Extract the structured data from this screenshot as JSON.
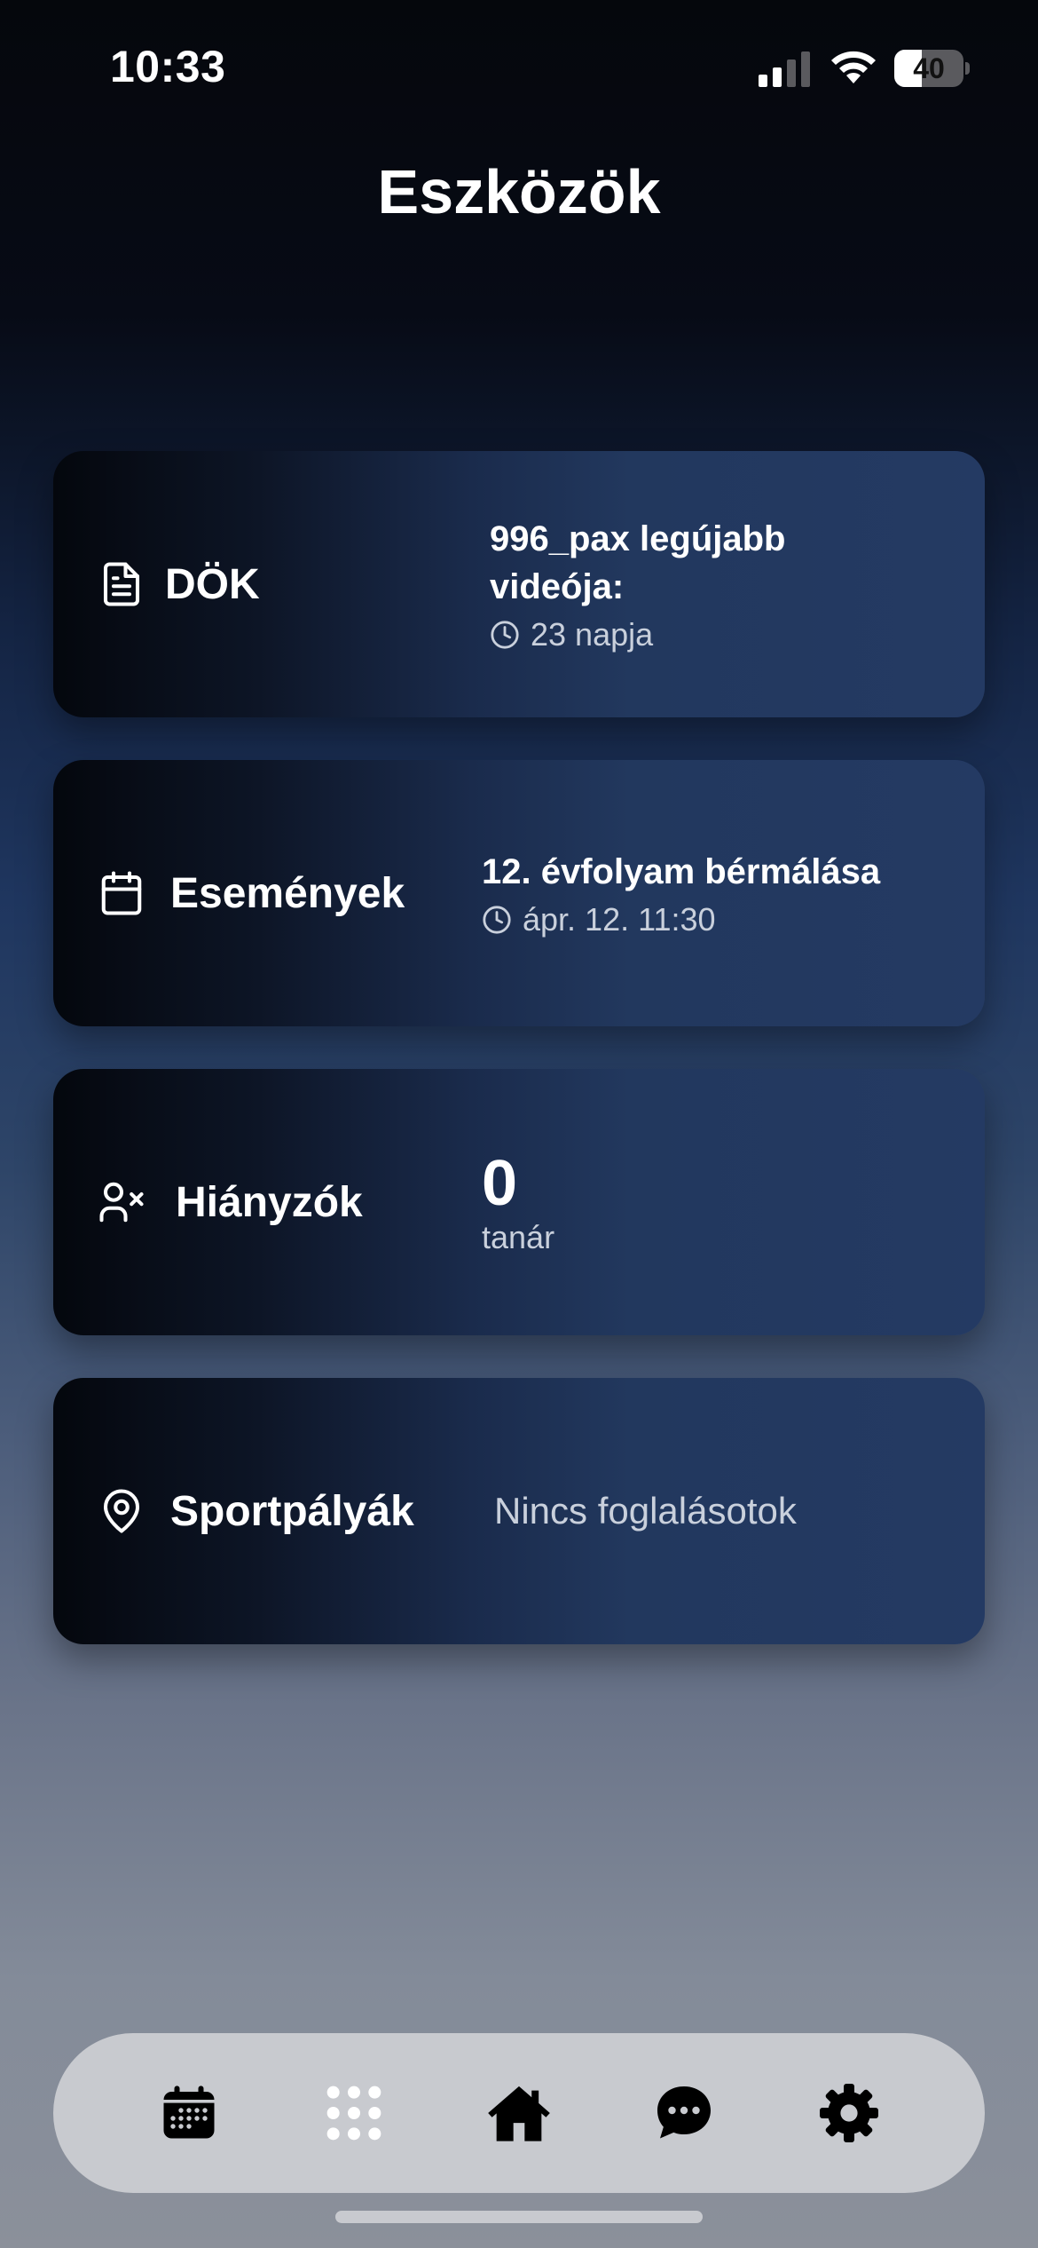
{
  "status_bar": {
    "time": "10:33",
    "battery_level": "40",
    "battery_fraction": 0.4
  },
  "page": {
    "title": "Eszközök"
  },
  "cards": [
    {
      "label": "DÖK",
      "icon": "document-icon",
      "info_title": "996_pax legújabb videója:",
      "info_meta": "23 napja"
    },
    {
      "label": "Események",
      "icon": "calendar-icon",
      "info_title": "12. évfolyam bérmálása",
      "info_meta": "ápr. 12. 11:30"
    },
    {
      "label": "Hiányzók",
      "icon": "user-x-icon",
      "count": "0",
      "count_label": "tanár"
    },
    {
      "label": "Sportpályák",
      "icon": "map-pin-icon",
      "status": "Nincs foglalásotok"
    }
  ],
  "tab_bar": {
    "items": [
      "calendar-icon",
      "grid-icon",
      "home-icon",
      "chat-icon",
      "gear-icon"
    ],
    "active_color": "#000000",
    "inactive_color": "#ffffff"
  }
}
